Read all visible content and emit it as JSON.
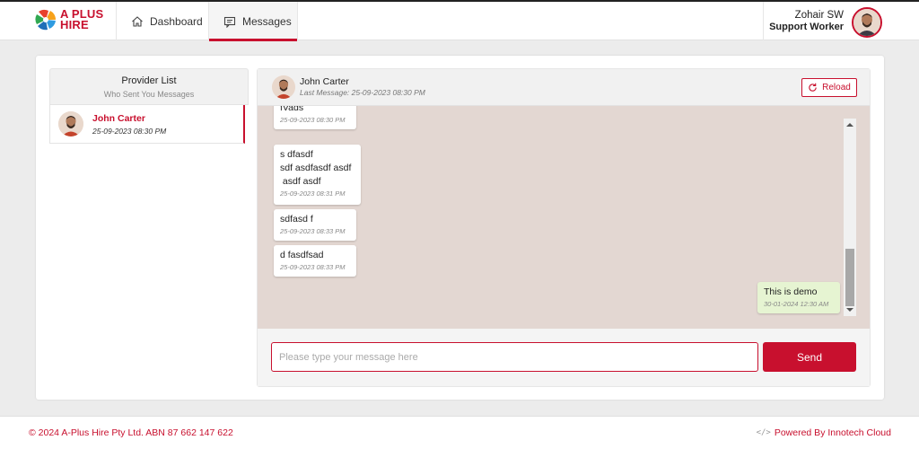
{
  "brand": {
    "logo_text_line1": "A PLUS",
    "logo_text_line2": "HIRE"
  },
  "nav": {
    "tabs": [
      {
        "label": "Dashboard",
        "icon": "home-icon"
      },
      {
        "label": "Messages",
        "icon": "message-icon",
        "active": true
      }
    ]
  },
  "user": {
    "name": "Zohair SW",
    "role": "Support Worker"
  },
  "provider_list": {
    "title": "Provider List",
    "subtitle": "Who Sent You Messages",
    "items": [
      {
        "name": "John Carter",
        "timestamp": "25-09-2023 08:30 PM"
      }
    ]
  },
  "chat": {
    "contact_name": "John Carter",
    "last_message": "Last Message: 25-09-2023 08:30 PM",
    "reload_label": "Reload",
    "messages": [
      {
        "text": "fVads",
        "time": "25-09-2023 08:30 PM",
        "side": "left"
      },
      {
        "text": "s dfasdf\nsdf asdfasdf asdf\n asdf asdf",
        "time": "25-09-2023 08:31 PM",
        "side": "left"
      },
      {
        "text": "sdfasd f",
        "time": "25-09-2023 08:33 PM",
        "side": "left"
      },
      {
        "text": "d fasdfsad",
        "time": "25-09-2023 08:33 PM",
        "side": "left"
      },
      {
        "text": "This is demo",
        "time": "30-01-2024 12:30 AM",
        "side": "right"
      }
    ],
    "input_placeholder": "Please type your message here",
    "input_value": "",
    "send_label": "Send"
  },
  "footer": {
    "copyright": "© 2024 A-Plus Hire Pty Ltd. ABN 87 662 147 622",
    "powered_by": "Powered By Innotech Cloud"
  },
  "colors": {
    "accent": "#c8102e",
    "chat_bg": "#e3d7d2",
    "own_bubble": "#e6f4d2"
  }
}
